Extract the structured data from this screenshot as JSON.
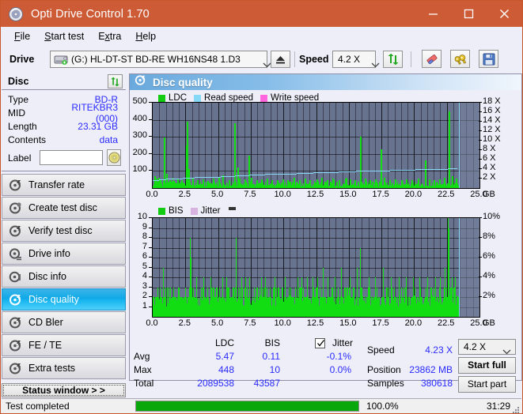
{
  "window": {
    "title": "Opti Drive Control 1.70",
    "icon": "disc-icon",
    "minimize": "–",
    "maximize": "□",
    "close": "✕",
    "accent": "#cd5b36"
  },
  "menu": [
    {
      "label": "File",
      "accel": "F"
    },
    {
      "label": "Start test",
      "accel": "S"
    },
    {
      "label": "Extra",
      "accel": "x"
    },
    {
      "label": "Help",
      "accel": "H"
    }
  ],
  "toolbar": {
    "drive_label": "Drive",
    "drive_value": "(G:)   HL-DT-ST BD-RE  WH16NS48 1.D3",
    "eject_icon": "eject-icon",
    "speed_label": "Speed",
    "speed_value": "4.2 X",
    "refresh_icon": "refresh-icon",
    "erase_icon": "eraser-icon",
    "tools_icon": "tools-icon",
    "save_icon": "save-icon"
  },
  "disc_panel": {
    "title": "Disc",
    "refresh_icon": "refresh-icon",
    "rows": [
      {
        "key": "Type",
        "value": "BD-R"
      },
      {
        "key": "MID",
        "value": "RITEKBR3 (000)"
      },
      {
        "key": "Length",
        "value": "23.31 GB"
      },
      {
        "key": "Contents",
        "value": "data"
      }
    ],
    "label_key": "Label",
    "label_value": "",
    "label_placeholder": "",
    "label_button_icon": "disc-icon"
  },
  "sidebar": {
    "items": [
      {
        "label": "Transfer rate",
        "icon": "disc-test-icon",
        "active": false
      },
      {
        "label": "Create test disc",
        "icon": "disc-burn-icon",
        "active": false
      },
      {
        "label": "Verify test disc",
        "icon": "disc-verify-icon",
        "active": false
      },
      {
        "label": "Drive info",
        "icon": "drive-info-icon",
        "active": false
      },
      {
        "label": "Disc info",
        "icon": "disc-info-icon",
        "active": false
      },
      {
        "label": "Disc quality",
        "icon": "disc-quality-icon",
        "active": true
      },
      {
        "label": "CD Bler",
        "icon": "cd-bler-icon",
        "active": false
      },
      {
        "label": "FE / TE",
        "icon": "fe-te-icon",
        "active": false
      },
      {
        "label": "Extra tests",
        "icon": "extra-tests-icon",
        "active": false
      }
    ],
    "status_window_button": "Status window > >"
  },
  "content": {
    "title": "Disc quality",
    "title_icon": "disc-quality-icon"
  },
  "stats": {
    "col_ldc": "LDC",
    "col_bis": "BIS",
    "jitter_label": "Jitter",
    "jitter_checked": true,
    "rows": [
      {
        "name": "Avg",
        "ldc": "5.47",
        "bis": "0.11",
        "jitter": "-0.1%"
      },
      {
        "name": "Max",
        "ldc": "448",
        "bis": "10",
        "jitter": "0.0%"
      },
      {
        "name": "Total",
        "ldc": "2089538",
        "bis": "43587",
        "jitter": ""
      }
    ],
    "speed_label": "Speed",
    "speed_value": "4.23 X",
    "position_label": "Position",
    "position_value": "23862 MB",
    "samples_label": "Samples",
    "samples_value": "380618",
    "speed_select": "4.2 X",
    "start_full": "Start full",
    "start_part": "Start part"
  },
  "statusbar": {
    "text": "Test completed",
    "progress_percent": "100.0%",
    "progress_value": 100,
    "elapsed": "31:29",
    "bar_color": "#0aa70a"
  },
  "chart_data": [
    {
      "type": "line",
      "name": "ldc-chart",
      "title": "",
      "legend": [
        {
          "label": "LDC",
          "color": "#12cc12"
        },
        {
          "label": "Read speed",
          "color": "#86d8f7"
        },
        {
          "label": "Write speed",
          "color": "#ff66dd"
        }
      ],
      "legend_position": "top-left",
      "xlabel": "GB",
      "ylabel": "LDC",
      "y2label": "X",
      "xlim": [
        0,
        25
      ],
      "ylim": [
        0,
        500
      ],
      "y2lim": [
        0,
        18
      ],
      "grid": true,
      "xticks": [
        "0.0",
        "2.5",
        "5.0",
        "7.5",
        "10.0",
        "12.5",
        "15.0",
        "17.5",
        "20.0",
        "22.5",
        "25.0"
      ],
      "yticks": [
        100,
        200,
        300,
        400,
        500
      ],
      "y2ticks": [
        "2 X",
        "4 X",
        "6 X",
        "8 X",
        "10 X",
        "12 X",
        "14 X",
        "16 X",
        "18 X"
      ],
      "data_end_gb": 23.4,
      "ldc_spikes": [
        [
          0.15,
          70
        ],
        [
          0.25,
          55
        ],
        [
          0.4,
          60
        ],
        [
          0.55,
          50
        ],
        [
          0.85,
          297
        ],
        [
          1.0,
          85
        ],
        [
          1.3,
          45
        ],
        [
          1.6,
          40
        ],
        [
          1.9,
          50
        ],
        [
          2.2,
          45
        ],
        [
          2.55,
          250
        ],
        [
          2.62,
          388
        ],
        [
          2.75,
          110
        ],
        [
          3.0,
          60
        ],
        [
          3.4,
          45
        ],
        [
          3.8,
          50
        ],
        [
          4.2,
          42
        ],
        [
          4.6,
          55
        ],
        [
          5.0,
          60
        ],
        [
          5.35,
          75
        ],
        [
          5.8,
          48
        ],
        [
          6.25,
          380
        ],
        [
          6.45,
          120
        ],
        [
          6.6,
          55
        ],
        [
          7.0,
          50
        ],
        [
          7.35,
          190
        ],
        [
          7.5,
          60
        ],
        [
          7.9,
          45
        ],
        [
          8.3,
          50
        ],
        [
          8.7,
          55
        ],
        [
          9.1,
          45
        ],
        [
          9.5,
          48
        ],
        [
          9.9,
          52
        ],
        [
          10.3,
          45
        ],
        [
          10.8,
          60
        ],
        [
          11.2,
          48
        ],
        [
          11.6,
          55
        ],
        [
          12.0,
          45
        ],
        [
          12.5,
          50
        ],
        [
          12.9,
          60
        ],
        [
          13.3,
          45
        ],
        [
          13.8,
          50
        ],
        [
          14.2,
          48
        ],
        [
          14.7,
          55
        ],
        [
          15.1,
          50
        ],
        [
          15.45,
          45
        ],
        [
          15.85,
          300
        ],
        [
          16.2,
          55
        ],
        [
          16.6,
          48
        ],
        [
          17.0,
          50
        ],
        [
          17.45,
          225
        ],
        [
          17.7,
          60
        ],
        [
          18.1,
          48
        ],
        [
          18.5,
          52
        ],
        [
          19.0,
          45
        ],
        [
          19.4,
          50
        ],
        [
          19.8,
          48
        ],
        [
          20.3,
          55
        ],
        [
          20.8,
          160
        ],
        [
          21.1,
          50
        ],
        [
          21.5,
          48
        ],
        [
          21.9,
          52
        ],
        [
          22.3,
          60
        ],
        [
          22.62,
          448
        ],
        [
          22.9,
          70
        ],
        [
          23.2,
          55
        ]
      ],
      "read_speed_profile": [
        [
          0.0,
          1.7
        ],
        [
          0.5,
          1.8
        ],
        [
          1.0,
          2.0
        ],
        [
          1.6,
          2.05
        ],
        [
          2.3,
          2.15
        ],
        [
          3.2,
          2.3
        ],
        [
          4.2,
          2.4
        ],
        [
          5.2,
          2.55
        ],
        [
          6.3,
          2.7
        ],
        [
          7.4,
          2.8
        ],
        [
          8.6,
          2.95
        ],
        [
          9.8,
          3.05
        ],
        [
          11.0,
          3.2
        ],
        [
          12.3,
          3.3
        ],
        [
          13.6,
          3.4
        ],
        [
          14.9,
          3.55
        ],
        [
          16.2,
          3.65
        ],
        [
          17.5,
          3.75
        ],
        [
          18.8,
          3.85
        ],
        [
          20.1,
          3.95
        ],
        [
          21.4,
          4.05
        ],
        [
          22.6,
          4.15
        ],
        [
          23.3,
          4.2
        ]
      ]
    },
    {
      "type": "line",
      "name": "bis-chart",
      "title": "",
      "legend": [
        {
          "label": "BIS",
          "color": "#12cc12"
        },
        {
          "label": "Jitter",
          "color": "#d9b3e0"
        }
      ],
      "legend_position": "top-left",
      "xlabel": "GB",
      "ylabel": "BIS",
      "y2label": "%",
      "xlim": [
        0,
        25
      ],
      "ylim": [
        0,
        10
      ],
      "y2lim": [
        0,
        10
      ],
      "grid": true,
      "xticks": [
        "0.0",
        "2.5",
        "5.0",
        "7.5",
        "10.0",
        "12.5",
        "15.0",
        "17.5",
        "20.0",
        "22.5",
        "25.0"
      ],
      "yticks": [
        1,
        2,
        3,
        4,
        5,
        6,
        7,
        8,
        9,
        10
      ],
      "y2ticks": [
        "2%",
        "4%",
        "6%",
        "8%",
        "10%"
      ],
      "data_end_gb": 23.4,
      "baseline": 2,
      "bis_spikes": [
        [
          0.8,
          5
        ],
        [
          0.9,
          1
        ],
        [
          1.15,
          1
        ],
        [
          2.85,
          8
        ],
        [
          2.9,
          6
        ],
        [
          3.3,
          4
        ],
        [
          3.9,
          4
        ],
        [
          4.4,
          4
        ],
        [
          5.3,
          4
        ],
        [
          5.6,
          4
        ],
        [
          6.35,
          8
        ],
        [
          6.8,
          4
        ],
        [
          7.1,
          4
        ],
        [
          7.4,
          4
        ],
        [
          8.3,
          4
        ],
        [
          8.6,
          4
        ],
        [
          9.3,
          4
        ],
        [
          10.1,
          4
        ],
        [
          11.1,
          4
        ],
        [
          11.4,
          4
        ],
        [
          11.8,
          4
        ],
        [
          12.2,
          4
        ],
        [
          12.6,
          4
        ],
        [
          13.0,
          5
        ],
        [
          13.4,
          4
        ],
        [
          13.9,
          4
        ],
        [
          14.4,
          5
        ],
        [
          15.1,
          4
        ],
        [
          15.6,
          5
        ],
        [
          15.85,
          7
        ],
        [
          16.5,
          4
        ],
        [
          17.0,
          4
        ],
        [
          17.6,
          5
        ],
        [
          18.2,
          4
        ],
        [
          18.8,
          4
        ],
        [
          19.4,
          4
        ],
        [
          19.9,
          4
        ],
        [
          20.4,
          4
        ],
        [
          21.0,
          4
        ],
        [
          21.6,
          4
        ],
        [
          22.0,
          4
        ],
        [
          22.35,
          5
        ],
        [
          22.6,
          10
        ],
        [
          22.65,
          9
        ],
        [
          22.9,
          4
        ],
        [
          23.1,
          4
        ]
      ]
    }
  ]
}
